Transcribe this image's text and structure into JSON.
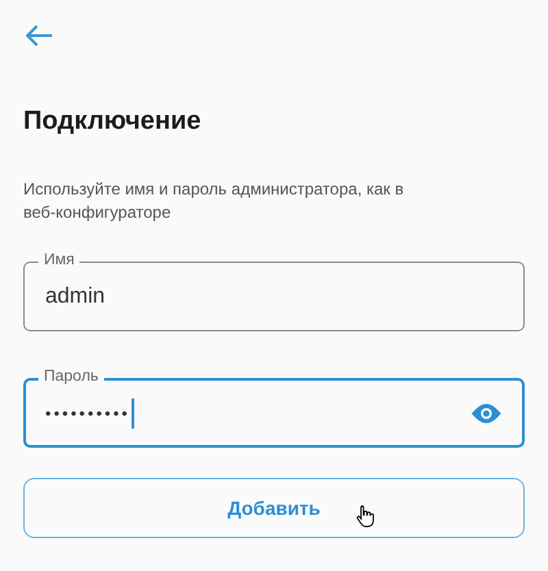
{
  "title": "Подключение",
  "description": "Используйте имя и пароль администратора, как в веб-конфигураторе",
  "fields": [
    {
      "kind": "text",
      "label": "Имя",
      "value": "admin",
      "focused": false
    },
    {
      "kind": "password",
      "label": "Пароль",
      "value": "••••••••••",
      "focused": true
    }
  ],
  "button": "Добавить"
}
